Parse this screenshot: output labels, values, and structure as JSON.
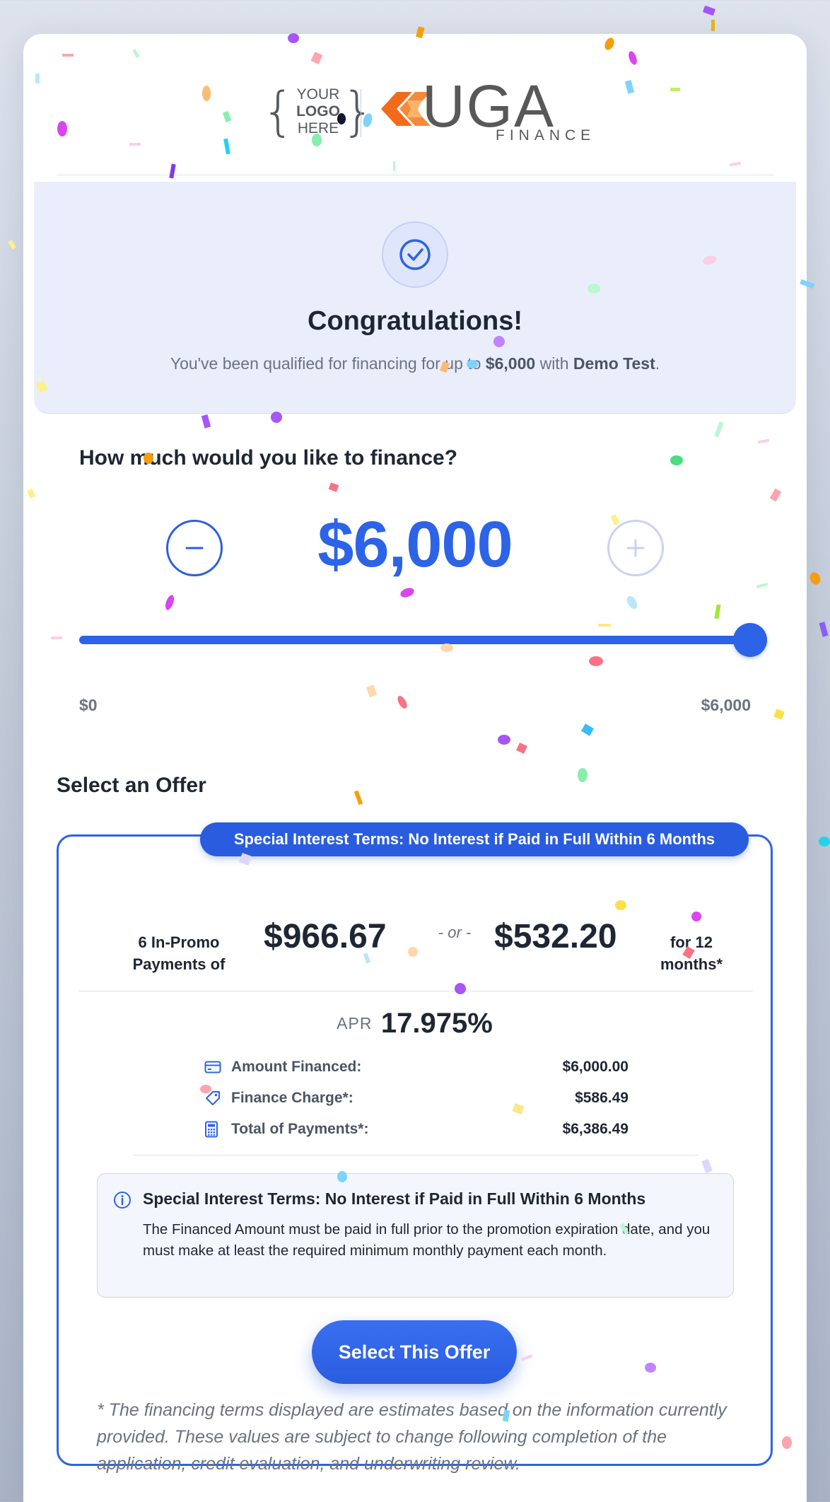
{
  "brand": {
    "partner_logo": {
      "top": "YOUR",
      "middle": "LOGO",
      "bottom": "HERE",
      "brace_open": "{",
      "brace_close": "}"
    },
    "finance_logo": {
      "word": "UGA",
      "sub": "FINANCE"
    }
  },
  "congrats": {
    "icon": "check-circle-icon",
    "title": "Congratulations!",
    "subtitle_prefix": "You've been qualified for financing for up to ",
    "max_amount": "$6,000",
    "subtitle_mid": " with ",
    "merchant": "Demo Test",
    "subtitle_suffix": "."
  },
  "finance_selector": {
    "question": "How much would you like to finance?",
    "amount": "$6,000",
    "decrement_icon": "minus-icon",
    "increment_icon": "plus-icon",
    "slider": {
      "min_label": "$0",
      "max_label": "$6,000",
      "value": 6000,
      "min": 0,
      "max": 6000
    }
  },
  "offers": {
    "heading": "Select an Offer",
    "items": [
      {
        "banner": "Special Interest Terms: No Interest if Paid in Full Within 6 Months",
        "promo_label": "6 In-Promo Payments of",
        "promo_amount": "$966.67",
        "or": "- or -",
        "std_amount": "$532.20",
        "std_label": "for 12 months*",
        "apr_label": "APR",
        "apr_value": "17.975%",
        "details": [
          {
            "icon": "credit-card-icon",
            "label": "Amount Financed:",
            "value": "$6,000.00"
          },
          {
            "icon": "tag-icon",
            "label": "Finance Charge*:",
            "value": "$586.49"
          },
          {
            "icon": "calculator-icon",
            "label": "Total of Payments*:",
            "value": "$6,386.49"
          }
        ],
        "info": {
          "icon": "info-icon",
          "title": "Special Interest Terms: No Interest if Paid in Full Within 6 Months",
          "body": "The Financed Amount must be paid in full prior to the promotion expiration date, and you must make at least the required minimum monthly payment each month."
        },
        "button": "Select This Offer",
        "disclaimer": "* The financing terms displayed are estimates based on the information currently provided. These values are subject to change following completion of the application, credit evaluation, and underwriting review."
      }
    ]
  },
  "colors": {
    "accent": "#2d63e6",
    "text": "#1f2633",
    "muted": "#6b7280",
    "congrats_bg": "#eaeefb",
    "logo_orange": "#f26b1d"
  }
}
